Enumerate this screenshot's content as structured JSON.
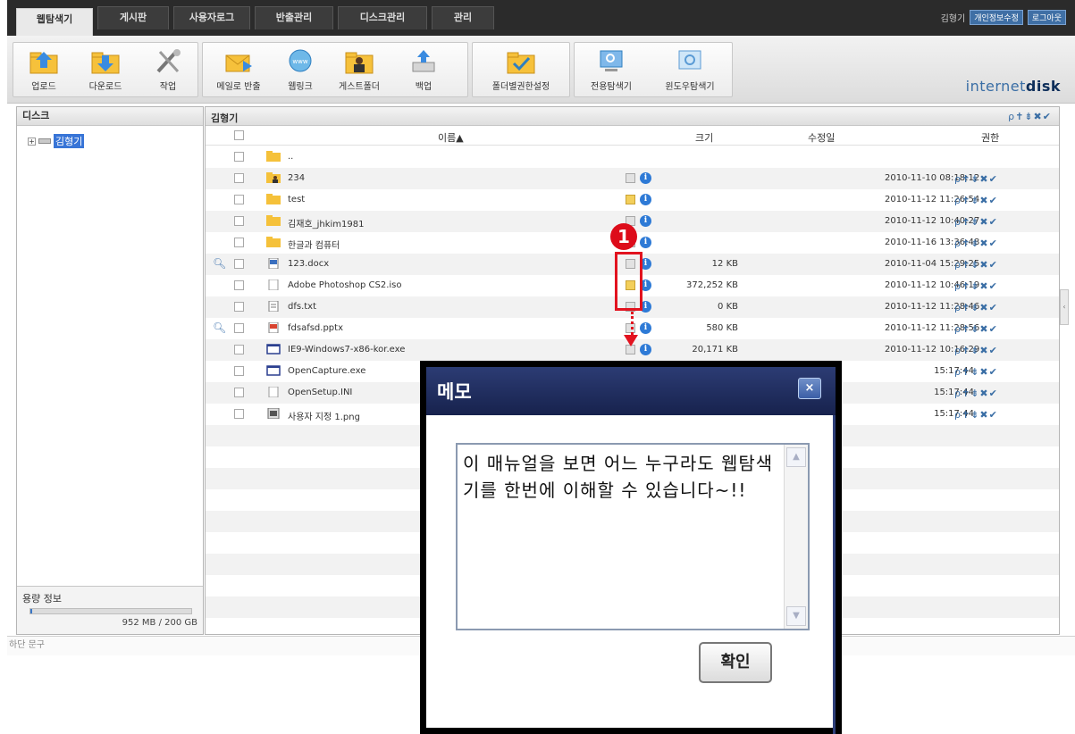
{
  "tabs": [
    "웹탐색기",
    "게시판",
    "사용자로그",
    "반출관리",
    "디스크관리",
    "관리"
  ],
  "user": {
    "name": "김형기",
    "edit_profile": "개인정보수정",
    "logout": "로그아웃"
  },
  "toolbar": {
    "buttons": [
      "업로드",
      "다운로드",
      "작업",
      "메일로 반출",
      "웹링크",
      "게스트폴더",
      "백업",
      "폴더별권한설정",
      "전용탐색기",
      "윈도우탐색기"
    ],
    "brand_prefix": "internet",
    "brand_suffix": "disk"
  },
  "left_panel": {
    "title": "디스크",
    "tree_root": "김형기",
    "quota_label": "용량 정보",
    "quota_text": "952 MB / 200 GB",
    "quota_fraction": 0.005
  },
  "footer_text": "하단 문구",
  "right_panel": {
    "path": "김형기",
    "header_perms": "ρ✝⇟✖✔",
    "columns": {
      "name": "이름▲",
      "size": "크기",
      "modified": "수정일",
      "perms": "권한"
    },
    "files": [
      {
        "name": "..",
        "icon": "folder-icon",
        "size": "",
        "date": "",
        "perms": "",
        "memo": "",
        "info": false,
        "preview": false
      },
      {
        "name": "234",
        "icon": "user-folder-icon",
        "size": "",
        "date": "2010-11-10 08:18:12",
        "perms": "ρ✝⇟✖✔",
        "memo": "plain",
        "info": true,
        "preview": false
      },
      {
        "name": "test",
        "icon": "folder-icon",
        "size": "",
        "date": "2010-11-12 11:26:54",
        "perms": "ρ✝⇟✖✔",
        "memo": "note",
        "info": true,
        "preview": false
      },
      {
        "name": "김재호_jhkim1981",
        "icon": "folder-icon",
        "size": "",
        "date": "2010-11-12 10:40:27",
        "perms": "ρ✝⇟✖✔",
        "memo": "plain",
        "info": true,
        "preview": false
      },
      {
        "name": "한글과 컴퓨터",
        "icon": "folder-icon",
        "size": "",
        "date": "2010-11-16 13:36:48",
        "perms": "ρ✝⇟✖✔",
        "memo": "plain",
        "info": true,
        "preview": false
      },
      {
        "name": "123.docx",
        "icon": "word-file-icon",
        "size": "12 KB",
        "date": "2010-11-04 15:29:25",
        "perms": "ρ✝⇟✖✔",
        "memo": "plain",
        "info": true,
        "preview": true
      },
      {
        "name": "Adobe Photoshop CS2.iso",
        "icon": "blank-file-icon",
        "size": "372,252 KB",
        "date": "2010-11-12 10:46:19",
        "perms": "ρ✝⇟✖✔",
        "memo": "note",
        "info": true,
        "preview": false
      },
      {
        "name": "dfs.txt",
        "icon": "text-file-icon",
        "size": "0 KB",
        "date": "2010-11-12 11:28:46",
        "perms": "ρ✝⇟✖✔",
        "memo": "plain",
        "info": true,
        "preview": false
      },
      {
        "name": "fdsafsd.pptx",
        "icon": "ppt-file-icon",
        "size": "580 KB",
        "date": "2010-11-12 11:28:56",
        "perms": "ρ✝⇟✖✔",
        "memo": "plain",
        "info": true,
        "preview": true
      },
      {
        "name": "IE9-Windows7-x86-kor.exe",
        "icon": "exe-file-icon",
        "size": "20,171 KB",
        "date": "2010-11-12 10:16:29",
        "perms": "ρ✝⇟✖✔",
        "memo": "plain",
        "info": true,
        "preview": false
      },
      {
        "name": "OpenCapture.exe",
        "icon": "exe-file-icon",
        "size": "",
        "date": "15:17:44",
        "perms": "ρ✝⇟✖✔",
        "memo": "",
        "info": false,
        "preview": false
      },
      {
        "name": "OpenSetup.INI",
        "icon": "blank-file-icon",
        "size": "",
        "date": "15:17:44",
        "perms": "ρ✝⇟✖✔",
        "memo": "",
        "info": false,
        "preview": false
      },
      {
        "name": "사용자 지정 1.png",
        "icon": "image-file-icon",
        "size": "",
        "date": "15:17:44",
        "perms": "ρ✝⇟✖✔",
        "memo": "",
        "info": false,
        "preview": false
      }
    ]
  },
  "annotation": {
    "badge": "1"
  },
  "memo_dialog": {
    "title": "메모",
    "close": "×",
    "text": "이 매뉴얼을 보면 어느 누구라도 웹탐색기를 한번에 이해할 수 있습니다~!!",
    "ok": "확인",
    "scroll_up": "▲",
    "scroll_down": "▼"
  },
  "colors": {
    "accent": "#3a6ea5",
    "annotation": "#e2131f",
    "dialog_header": "#1f2c5e"
  }
}
